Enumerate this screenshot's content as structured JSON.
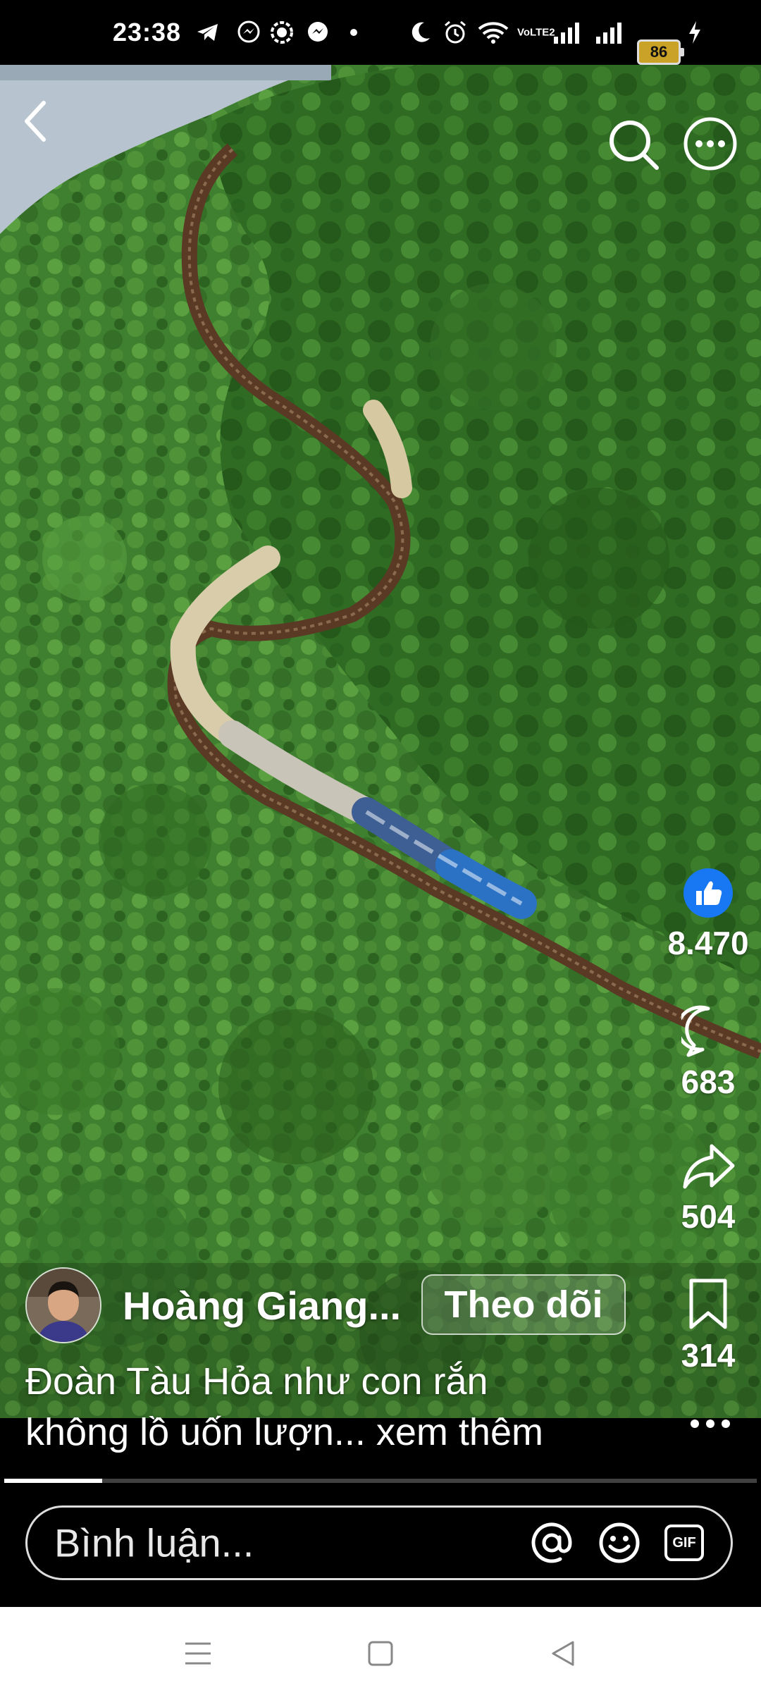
{
  "status_bar": {
    "time": "23:38",
    "battery": "86",
    "icons": [
      "telegram-icon",
      "messenger-icon",
      "chat-icon",
      "messenger-icon",
      "dot-icon",
      "moon-icon",
      "alarm-icon",
      "wifi-icon",
      "volte-icon",
      "signal-icon",
      "signal-icon",
      "battery-icon",
      "charging-icon"
    ],
    "volte_label": "VoLTE2"
  },
  "video": {
    "description_icons": [
      "back-icon",
      "search-icon",
      "more-icon"
    ]
  },
  "actions": {
    "like_count": "8.470",
    "comment_count": "683",
    "share_count": "504",
    "save_count": "314",
    "like_color": "#1877f2"
  },
  "author": {
    "name": "Hoàng Giang...",
    "follow_label": "Theo dõi"
  },
  "caption": {
    "text_line1": "Đoàn Tàu Hỏa như con rắn",
    "text_line2": "không lồ uốn lượn...",
    "more_label": "xem thêm"
  },
  "progress": {
    "fraction": 0.13
  },
  "comment_bar": {
    "placeholder": "Bình luận...",
    "gif_label": "GIF"
  }
}
